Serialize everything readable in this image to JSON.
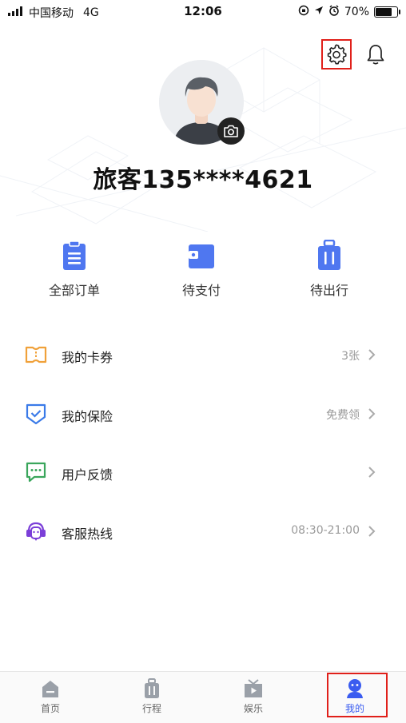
{
  "status_bar": {
    "carrier": "中国移动",
    "network": "4G",
    "time": "12:06",
    "battery_percent": "70%",
    "battery_level": 0.7
  },
  "profile": {
    "username": "旅客135****4621"
  },
  "orders": [
    {
      "label": "全部订单",
      "icon": "clipboard-icon"
    },
    {
      "label": "待支付",
      "icon": "wallet-icon"
    },
    {
      "label": "待出行",
      "icon": "luggage-icon"
    }
  ],
  "menu": [
    {
      "label": "我的卡券",
      "value": "3张",
      "icon": "ticket-icon",
      "color": "#f0a13a"
    },
    {
      "label": "我的保险",
      "value": "免费领",
      "icon": "shield-check-icon",
      "color": "#3a7ae8"
    },
    {
      "label": "用户反馈",
      "value": "",
      "icon": "chat-bubble-icon",
      "color": "#3aa65c"
    },
    {
      "label": "客服热线",
      "value": "08:30-21:00",
      "icon": "headset-icon",
      "color": "#7b3fd8"
    }
  ],
  "tabs": [
    {
      "label": "首页",
      "icon": "home-icon"
    },
    {
      "label": "行程",
      "icon": "suitcase-icon"
    },
    {
      "label": "娱乐",
      "icon": "tv-play-icon"
    },
    {
      "label": "我的",
      "icon": "person-icon"
    }
  ],
  "colors": {
    "accent": "#3a5cf0",
    "highlight_box": "#e0201a"
  }
}
